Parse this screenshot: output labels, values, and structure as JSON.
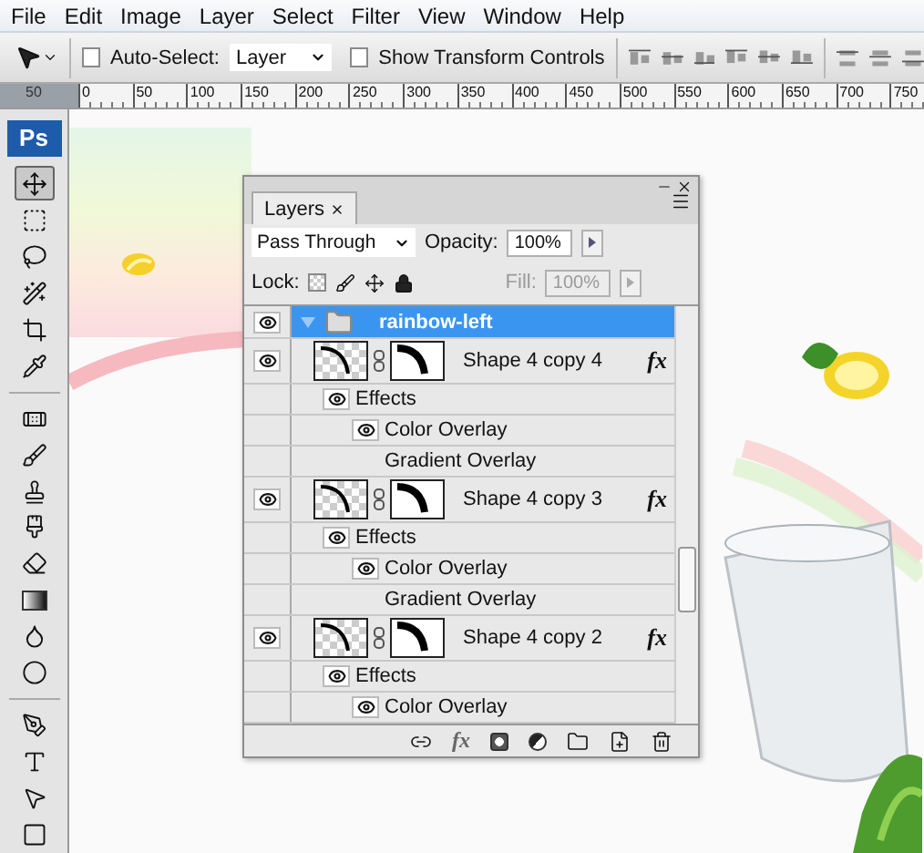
{
  "menu": [
    "File",
    "Edit",
    "Image",
    "Layer",
    "Select",
    "Filter",
    "View",
    "Window",
    "Help"
  ],
  "options_bar": {
    "auto_select": {
      "label": "Auto-Select:",
      "checked": false
    },
    "target": "Layer",
    "transform_controls": {
      "label": "Show Transform Controls",
      "checked": false
    }
  },
  "ruler": [
    "50",
    "0",
    "50",
    "100",
    "150",
    "200",
    "250",
    "300",
    "350",
    "400",
    "450",
    "500",
    "550",
    "600",
    "650",
    "700",
    "750"
  ],
  "tools": {
    "logo": "Ps",
    "groups": [
      [
        {
          "selected": true
        },
        {
          "selected": false
        },
        {
          "selected": false
        },
        {
          "selected": false
        },
        {
          "selected": false
        },
        {
          "selected": false
        }
      ],
      [
        {
          "selected": false
        },
        {
          "selected": false
        },
        {
          "selected": false
        },
        {
          "selected": false
        },
        {
          "selected": false
        },
        {
          "selected": false
        },
        {
          "selected": false
        },
        {
          "selected": false
        }
      ],
      [
        {
          "selected": false
        },
        {
          "selected": false
        },
        {
          "selected": false
        },
        {
          "selected": false
        }
      ]
    ]
  },
  "layers_panel": {
    "tab": "Layers",
    "blend_mode": "Pass Through",
    "opacity_label": "Opacity:",
    "opacity": "100%",
    "lock_label": "Lock:",
    "fill_label": "Fill:",
    "fill": "100%",
    "fill_disabled": true,
    "layers": [
      {
        "kind": "group",
        "name": "rainbow-left",
        "visible": true,
        "expanded": true,
        "selected": true,
        "children": [
          {
            "kind": "shape",
            "name": "Shape 4 copy 4",
            "visible": true,
            "selected": false,
            "fx": "fx",
            "effects": {
              "label": "Effects",
              "visible": true,
              "items": [
                {
                  "name": "Color Overlay",
                  "visible": true
                },
                {
                  "name": "Gradient Overlay",
                  "visible": false
                }
              ]
            }
          },
          {
            "kind": "shape",
            "name": "Shape 4 copy 3",
            "visible": true,
            "selected": false,
            "fx": "fx",
            "effects": {
              "label": "Effects",
              "visible": true,
              "items": [
                {
                  "name": "Color Overlay",
                  "visible": true
                },
                {
                  "name": "Gradient Overlay",
                  "visible": false
                }
              ]
            }
          },
          {
            "kind": "shape",
            "name": "Shape 4 copy 2",
            "visible": true,
            "selected": false,
            "fx": "fx",
            "effects": {
              "label": "Effects",
              "visible": true,
              "items": [
                {
                  "name": "Color Overlay",
                  "visible": true
                }
              ]
            }
          }
        ]
      }
    ],
    "bottom_fx": "fx"
  }
}
